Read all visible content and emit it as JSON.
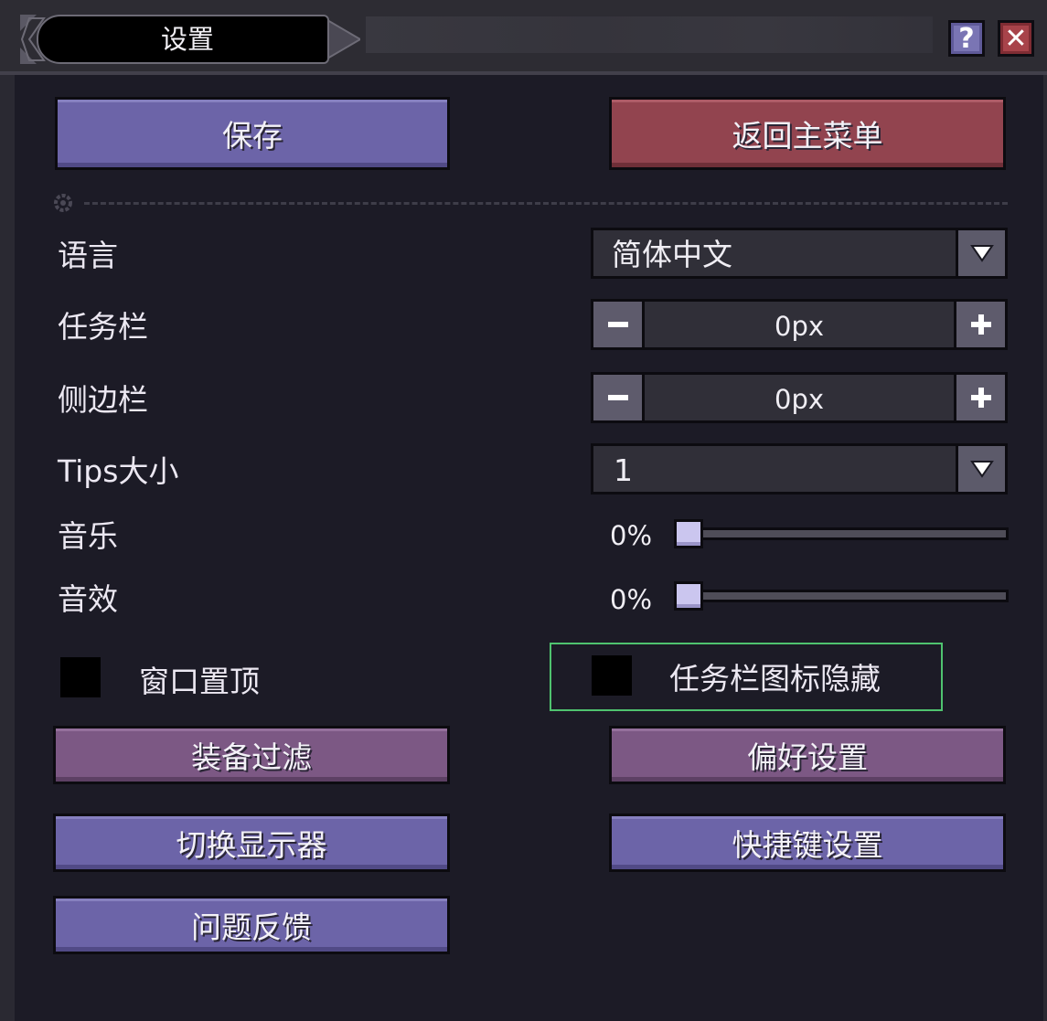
{
  "window": {
    "title": "设置",
    "help_label": "?",
    "close_label": "✕"
  },
  "top_buttons": {
    "save": "保存",
    "main_menu": "返回主菜单"
  },
  "settings": {
    "language": {
      "label": "语言",
      "value": "简体中文"
    },
    "taskbar": {
      "label": "任务栏",
      "value": "0",
      "unit": "px"
    },
    "sidebar": {
      "label": "侧边栏",
      "value": "0",
      "unit": "px"
    },
    "tips_size": {
      "label": "Tips大小",
      "value": "1"
    },
    "music": {
      "label": "音乐",
      "value_text": "0%",
      "value": 0
    },
    "sfx": {
      "label": "音效",
      "value_text": "0%",
      "value": 0
    }
  },
  "checkboxes": {
    "always_on_top": {
      "label": "窗口置顶",
      "checked": false
    },
    "hide_taskbar_icon": {
      "label": "任务栏图标隐藏",
      "checked": false
    }
  },
  "bottom_buttons": {
    "equipment_filter": "装备过滤",
    "preferences": "偏好设置",
    "switch_display": "切换显示器",
    "hotkeys": "快捷键设置",
    "feedback": "问题反馈"
  },
  "icons": {
    "help": "help-icon",
    "close": "close-icon",
    "dropdown": "triangle-down-icon",
    "minus": "minus-icon",
    "plus": "plus-icon",
    "divider": "gear-icon"
  },
  "colors": {
    "background": "#1c1b26",
    "button_blue": "#6c64a8",
    "button_red": "#92444f",
    "button_purple": "#7c5884",
    "focus_green": "#4fc36f",
    "slider_thumb": "#cbc6ef"
  }
}
